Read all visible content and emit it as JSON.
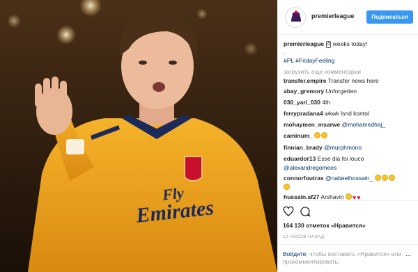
{
  "post": {
    "username": "premierleague",
    "follow_label": "Подписаться",
    "caption_user": "premierleague",
    "caption_number": "4",
    "caption_text": " weeks today!",
    "caption_dot": ".",
    "hashtags": "#PL #FridayFeeling",
    "load_more": "загрузить еще комментарии"
  },
  "comments": [
    {
      "user": "transfer.empire",
      "text": "Transfer news here"
    },
    {
      "user": "abay_gremory",
      "text": "Unforgetten"
    },
    {
      "user": "030_yari_030",
      "text": "4th"
    },
    {
      "user": "ferrypradana4",
      "text": "wkwk lsnd kontol"
    },
    {
      "user": "mohaymen_msarwe",
      "text": "@mohamedhaj_"
    },
    {
      "user": "caminum_",
      "text": ""
    },
    {
      "user": "finnian_brady",
      "text": "@murphmono"
    },
    {
      "user": "eduardor13",
      "text": "Esse dia foi louco",
      "text2": "@alexandregomees"
    },
    {
      "user": "connorfoutras",
      "text": "@nabeelhossain_"
    },
    {
      "user": "hussain.af27",
      "text": "Arshavin"
    }
  ],
  "footer": {
    "likes": "164 130 отметок «Нравится»",
    "time": "12 ЧАСОВ НАЗАД",
    "login_link": "Войдите",
    "login_text": ", чтобы поставить «Нравится» или прокомментировать.",
    "more": "..."
  },
  "photo_text": {
    "sponsor_line1": "Fly",
    "sponsor_line2": "Emirates"
  },
  "colors": {
    "follow_blue": "#3897f0",
    "link_blue": "#003569",
    "kit_yellow": "#f2a71b"
  }
}
